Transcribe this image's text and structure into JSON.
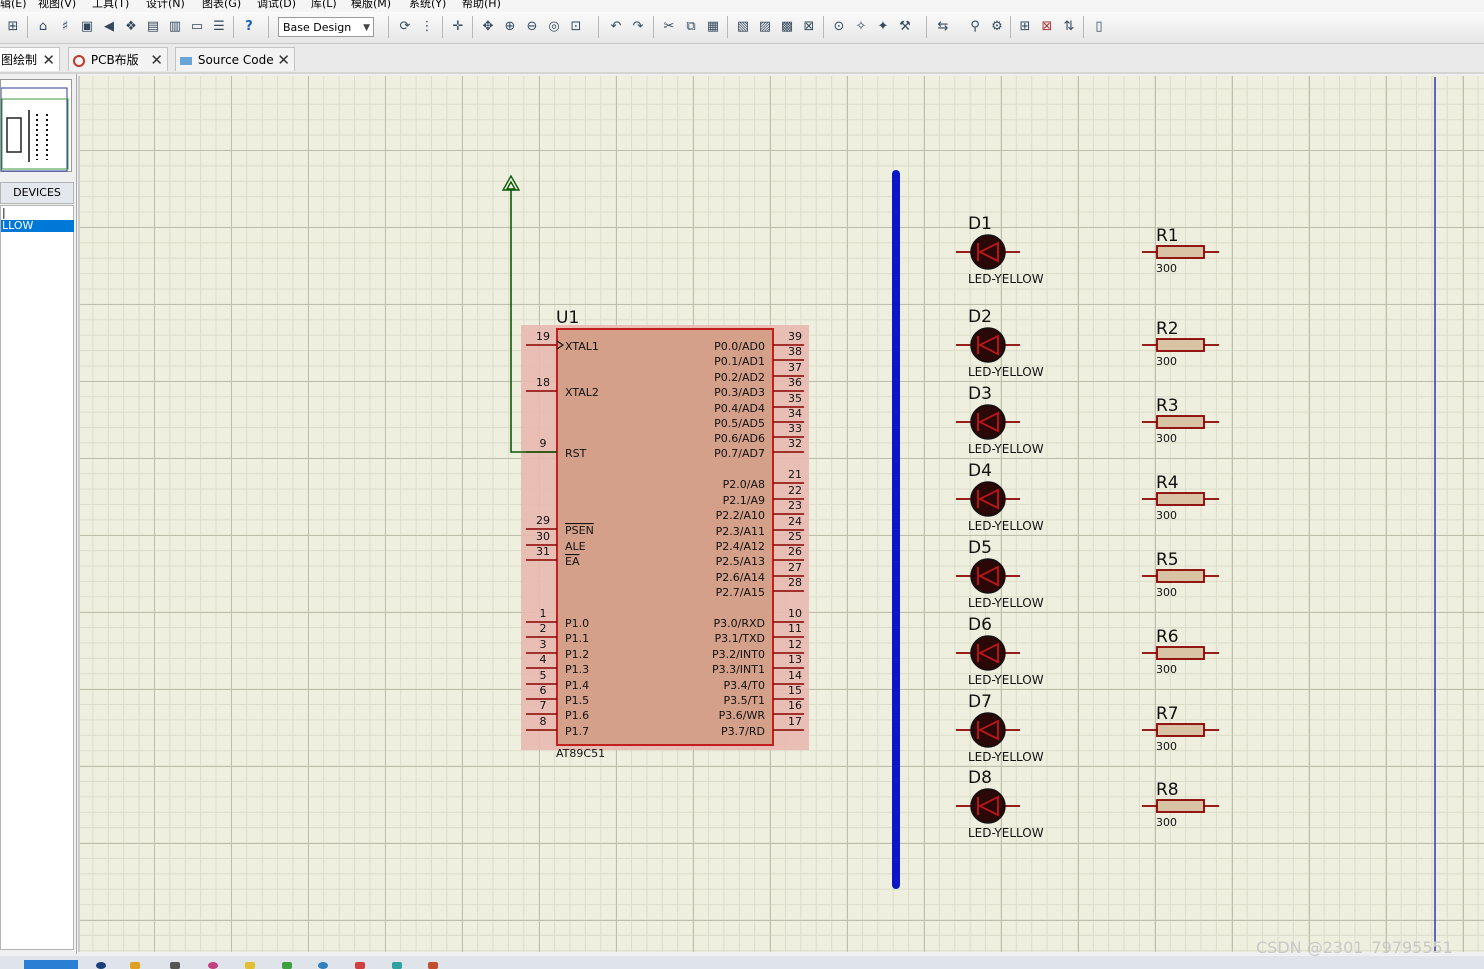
{
  "menu": [
    "辑(E)",
    "视图(V)",
    "工具(T)",
    "设计(N)",
    "图表(G)",
    "调试(D)",
    "库(L)",
    "模版(M)",
    "系统(Y)",
    "帮助(H)"
  ],
  "toolbar": {
    "design_select": "Base Design"
  },
  "tabs": [
    {
      "label": "图绘制",
      "active": true
    },
    {
      "label": "PCB布版",
      "active": false
    },
    {
      "label": "Source Code",
      "active": false
    }
  ],
  "left_panel": {
    "devices_header": "DEVICES",
    "items": [
      "|",
      "LLOW"
    ]
  },
  "schematic": {
    "chip": {
      "ref": "U1",
      "part": "AT89C51",
      "left_pins": [
        {
          "num": "19",
          "name": "XTAL1"
        },
        {
          "num": "18",
          "name": "XTAL2"
        },
        {
          "num": "9",
          "name": "RST"
        },
        {
          "num": "29",
          "name": "PSEN"
        },
        {
          "num": "30",
          "name": "ALE"
        },
        {
          "num": "31",
          "name": "EA"
        },
        {
          "num": "1",
          "name": "P1.0"
        },
        {
          "num": "2",
          "name": "P1.1"
        },
        {
          "num": "3",
          "name": "P1.2"
        },
        {
          "num": "4",
          "name": "P1.3"
        },
        {
          "num": "5",
          "name": "P1.4"
        },
        {
          "num": "6",
          "name": "P1.5"
        },
        {
          "num": "7",
          "name": "P1.6"
        },
        {
          "num": "8",
          "name": "P1.7"
        }
      ],
      "right_pins": [
        {
          "num": "39",
          "name": "P0.0/AD0"
        },
        {
          "num": "38",
          "name": "P0.1/AD1"
        },
        {
          "num": "37",
          "name": "P0.2/AD2"
        },
        {
          "num": "36",
          "name": "P0.3/AD3"
        },
        {
          "num": "35",
          "name": "P0.4/AD4"
        },
        {
          "num": "34",
          "name": "P0.5/AD5"
        },
        {
          "num": "33",
          "name": "P0.6/AD6"
        },
        {
          "num": "32",
          "name": "P0.7/AD7"
        },
        {
          "num": "21",
          "name": "P2.0/A8"
        },
        {
          "num": "22",
          "name": "P2.1/A9"
        },
        {
          "num": "23",
          "name": "P2.2/A10"
        },
        {
          "num": "24",
          "name": "P2.3/A11"
        },
        {
          "num": "25",
          "name": "P2.4/A12"
        },
        {
          "num": "26",
          "name": "P2.5/A13"
        },
        {
          "num": "27",
          "name": "P2.6/A14"
        },
        {
          "num": "28",
          "name": "P2.7/A15"
        },
        {
          "num": "10",
          "name": "P3.0/RXD"
        },
        {
          "num": "11",
          "name": "P3.1/TXD"
        },
        {
          "num": "12",
          "name": "P3.2/INT0"
        },
        {
          "num": "13",
          "name": "P3.3/INT1"
        },
        {
          "num": "14",
          "name": "P3.4/T0"
        },
        {
          "num": "15",
          "name": "P3.5/T1"
        },
        {
          "num": "16",
          "name": "P3.6/WR"
        },
        {
          "num": "17",
          "name": "P3.7/RD"
        }
      ]
    },
    "leds": [
      {
        "ref": "D1",
        "value": "LED-YELLOW"
      },
      {
        "ref": "D2",
        "value": "LED-YELLOW"
      },
      {
        "ref": "D3",
        "value": "LED-YELLOW"
      },
      {
        "ref": "D4",
        "value": "LED-YELLOW"
      },
      {
        "ref": "D5",
        "value": "LED-YELLOW"
      },
      {
        "ref": "D6",
        "value": "LED-YELLOW"
      },
      {
        "ref": "D7",
        "value": "LED-YELLOW"
      },
      {
        "ref": "D8",
        "value": "LED-YELLOW"
      }
    ],
    "resistors": [
      {
        "ref": "R1",
        "value": "300"
      },
      {
        "ref": "R2",
        "value": "300"
      },
      {
        "ref": "R3",
        "value": "300"
      },
      {
        "ref": "R4",
        "value": "300"
      },
      {
        "ref": "R5",
        "value": "300"
      },
      {
        "ref": "R6",
        "value": "300"
      },
      {
        "ref": "R7",
        "value": "300"
      },
      {
        "ref": "R8",
        "value": "300"
      }
    ]
  },
  "colors": {
    "chip_body": "#d4a08a",
    "chip_border": "#c0201e",
    "pin": "#8b0000",
    "bus": "#0a18c8",
    "wire": "#0a5a0a",
    "resistor": "#d8c3a5"
  },
  "watermark": "CSDN @2301_79795551"
}
